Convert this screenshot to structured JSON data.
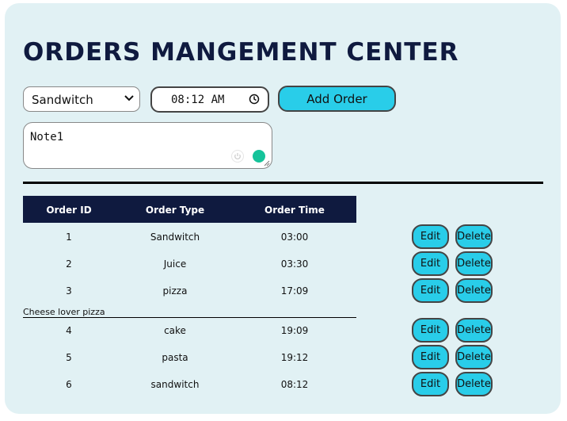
{
  "header": {
    "title": "ORDERS MANGEMENT CENTER"
  },
  "form": {
    "order_type_selected": "Sandwitch",
    "time_value": "08:12 AM",
    "add_label": "Add Order",
    "note_value": "Note1"
  },
  "table": {
    "headers": [
      "Order ID",
      "Order Type",
      "Order Time"
    ],
    "rows": [
      {
        "id": "1",
        "type": "Sandwitch",
        "time": "03:00"
      },
      {
        "id": "2",
        "type": "Juice",
        "time": "03:30"
      },
      {
        "id": "3",
        "type": "pizza",
        "time": "17:09"
      },
      {
        "id": "4",
        "type": "cake",
        "time": "19:09"
      },
      {
        "id": "5",
        "type": "pasta",
        "time": "19:12"
      },
      {
        "id": "6",
        "type": "sandwitch",
        "time": "08:12"
      }
    ],
    "row_note": "Cheese lover pizza"
  },
  "actions": {
    "edit_label": "Edit",
    "delete_label": "Delete"
  },
  "colors": {
    "accent": "#29cde9",
    "header_bg": "#0f1a3f",
    "panel_bg": "#e1f1f4",
    "title": "#0f1a3f"
  }
}
